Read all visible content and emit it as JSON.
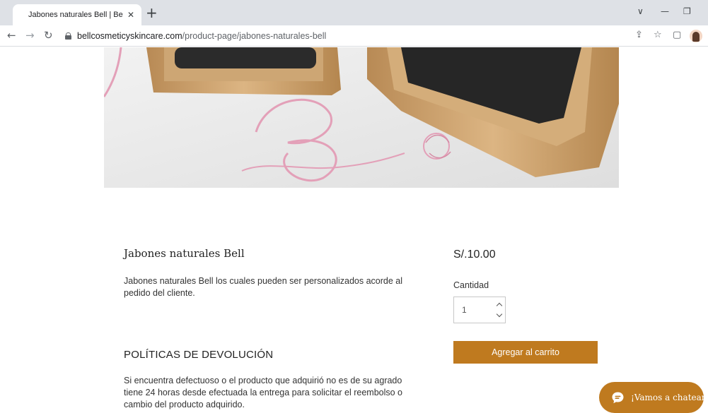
{
  "browser": {
    "tab_title": "Jabones naturales Bell | Bell Cosr",
    "tab_close": "✕",
    "new_tab": "+",
    "url_host": "bellcosmeticyskincare.com",
    "url_path": "/product-page/jabones-naturales-bell"
  },
  "hero": {
    "monogram": "B",
    "colors": {
      "background": "#ececec",
      "wood": "#c9a06a",
      "soap": "#2a2a2a",
      "monogram": "#e3a0b8"
    }
  },
  "product": {
    "title": "Jabones naturales Bell",
    "description": "Jabones naturales Bell los cuales pueden ser personalizados acorde al pedido del cliente.",
    "price": "S/.10.00",
    "quantity_label": "Cantidad",
    "quantity_value": "1",
    "add_to_cart": "Agregar al carrito"
  },
  "policies": {
    "title": "POLÍTICAS DE DEVOLUCIÓN",
    "text": "Si encuentra defectuoso o el producto que adquirió no es de su agrado tiene 24 horas desde efectuada la entrega para solicitar el reembolso o cambio del producto adquirido."
  },
  "chat": {
    "label": "¡Vamos a chatear!"
  },
  "colors": {
    "accent": "#bf7a1f",
    "text": "#333333"
  }
}
